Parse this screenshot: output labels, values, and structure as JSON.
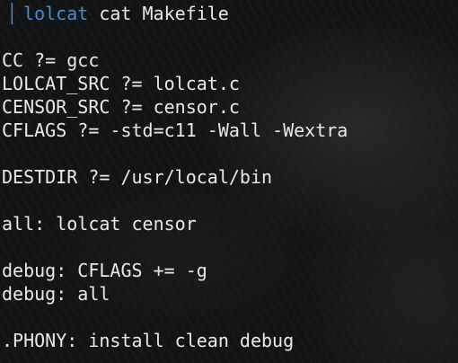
{
  "terminal": {
    "prompt": {
      "icon": "terminal-prompt-icon",
      "command": "lolcat",
      "args": " cat Makefile"
    },
    "lines": [
      "CC ?= gcc",
      "LOLCAT_SRC ?= lolcat.c",
      "CENSOR_SRC ?= censor.c",
      "CFLAGS ?= -std=c11 -Wall -Wextra",
      "DESTDIR ?= /usr/local/bin",
      "all: lolcat censor",
      "debug: CFLAGS += -g",
      "debug: all",
      ".PHONY: install clean debug"
    ]
  },
  "colors": {
    "command": "#3f8fd8",
    "text": "#e9e9e9",
    "background": "#121315"
  }
}
